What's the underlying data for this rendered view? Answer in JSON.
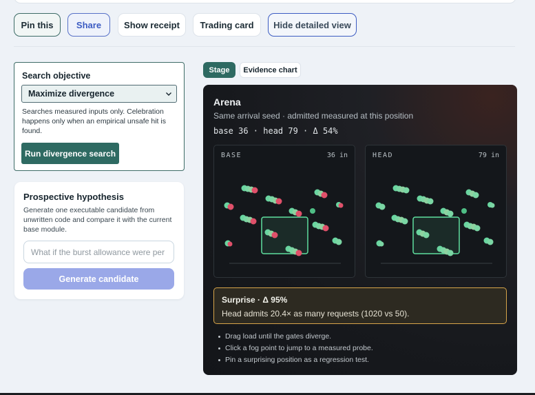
{
  "toolbar": {
    "pin_label": "Pin this",
    "share_label": "Share",
    "receipt_label": "Show receipt",
    "trading_card_label": "Trading card",
    "hide_detail_label": "Hide detailed view"
  },
  "objective": {
    "title": "Search objective",
    "selected": "Maximize divergence",
    "note": "Searches measured inputs only. Celebration happens only when an empirical unsafe hit is found.",
    "run_label": "Run divergence search"
  },
  "hypothesis": {
    "title": "Prospective hypothesis",
    "note": "Generate one executable candidate from unwritten code and compare it with the current base module.",
    "placeholder": "What if the burst allowance were per",
    "generate_label": "Generate candidate"
  },
  "tabs": {
    "stage_label": "Stage",
    "evidence_label": "Evidence chart"
  },
  "arena": {
    "title": "Arena",
    "subtitle": "Same arrival seed · admitted measured at this position",
    "stats": "base 36 · head 79 · Δ 54%",
    "base": {
      "label": "BASE",
      "count": "36 in"
    },
    "head": {
      "label": "HEAD",
      "count": "79 in"
    }
  },
  "surprise": {
    "title": "Surprise · Δ 95%",
    "text": "Head admits 20.4× as many requests (1020 vs 50)."
  },
  "tips": [
    "Drag load until the gates diverge.",
    "Click a fog point to jump to a measured probe.",
    "Pin a surprising position as a regression test."
  ],
  "colors": {
    "accent_teal": "#2e6a62",
    "accent_blue": "#3b5bc2",
    "admitted_green": "#5fe0a0",
    "rejected_red": "#e0506a",
    "warning_gold": "#d8a54a"
  }
}
